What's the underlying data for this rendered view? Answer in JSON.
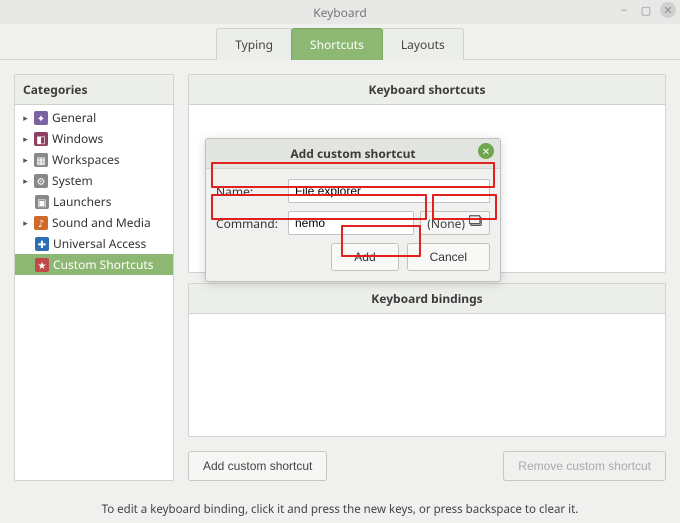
{
  "window": {
    "title": "Keyboard"
  },
  "tabs": [
    {
      "label": "Typing",
      "active": false
    },
    {
      "label": "Shortcuts",
      "active": true
    },
    {
      "label": "Layouts",
      "active": false
    }
  ],
  "sidebar": {
    "header": "Categories",
    "items": [
      {
        "label": "General",
        "icon": "general",
        "expandable": true
      },
      {
        "label": "Windows",
        "icon": "windows",
        "expandable": true
      },
      {
        "label": "Workspaces",
        "icon": "workspaces",
        "expandable": true
      },
      {
        "label": "System",
        "icon": "system",
        "expandable": true
      },
      {
        "label": "Launchers",
        "icon": "launchers",
        "child": true
      },
      {
        "label": "Sound and Media",
        "icon": "sound",
        "expandable": true
      },
      {
        "label": "Universal Access",
        "icon": "universal",
        "child": true
      },
      {
        "label": "Custom Shortcuts",
        "icon": "custom",
        "child": true,
        "selected": true
      }
    ]
  },
  "panels": {
    "shortcuts_header": "Keyboard shortcuts",
    "bindings_header": "Keyboard bindings"
  },
  "buttons": {
    "add_custom": "Add custom shortcut",
    "remove_custom": "Remove custom shortcut"
  },
  "footer": {
    "hint": "To edit a keyboard binding, click it and press the new keys, or press backspace to clear it."
  },
  "dialog": {
    "title": "Add custom shortcut",
    "name_label": "Name:",
    "name_value": "File explorer",
    "command_label": "Command:",
    "command_value": "nemo",
    "picker_label": "(None)",
    "add_label": "Add",
    "cancel_label": "Cancel"
  }
}
